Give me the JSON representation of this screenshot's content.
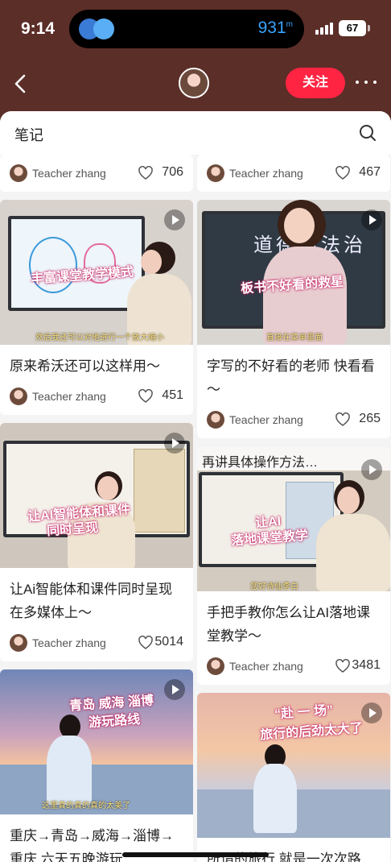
{
  "status": {
    "time": "9:14",
    "altitude": "931",
    "altitude_unit": "m",
    "battery": "67"
  },
  "nav": {
    "follow_label": "关注"
  },
  "sheet": {
    "title": "笔记"
  },
  "left": [
    {
      "author": "Teacher zhang",
      "likes": "706"
    },
    {
      "title": "原来希沃还可以这样用～",
      "author": "Teacher zhang",
      "likes": "451",
      "cap": "丰富课堂教学模式",
      "sub": "然后我还可以对他进行一个放大缩小"
    },
    {
      "title": "让Ai智能体和课件同时呈现在多媒体上～",
      "author": "Teacher zhang",
      "likes": "5014",
      "cap1": "让AI智能体和课件",
      "cap2": "同时呈现"
    },
    {
      "title": "重庆→青岛→威海→淄博→重庆 六天五晚游玩",
      "cap1": "青岛 威海 淄博",
      "cap2": "游玩路线",
      "sub": "这里真的真的真的太美了"
    }
  ],
  "right": [
    {
      "author": "Teacher zhang",
      "likes": "467"
    },
    {
      "title": "字写的不好看的老师 快看看～",
      "author": "Teacher zhang",
      "likes": "265",
      "cap": "板书不好看的救星",
      "sub": "直接在菜单里面",
      "board_text": "道德与法治"
    },
    {
      "title": "手把手教你怎么让AI落地课堂教学～",
      "author": "Teacher zhang",
      "likes": "3481",
      "top": "再讲具体操作方法…",
      "cap1": "让AI",
      "cap2": "落地课堂教学",
      "sub": "您好诗仙李白"
    },
    {
      "title": "所谓的旅行 就是一次次路",
      "cap1": "“赴 一 场”",
      "cap2": "旅行的后劲太大了"
    }
  ]
}
